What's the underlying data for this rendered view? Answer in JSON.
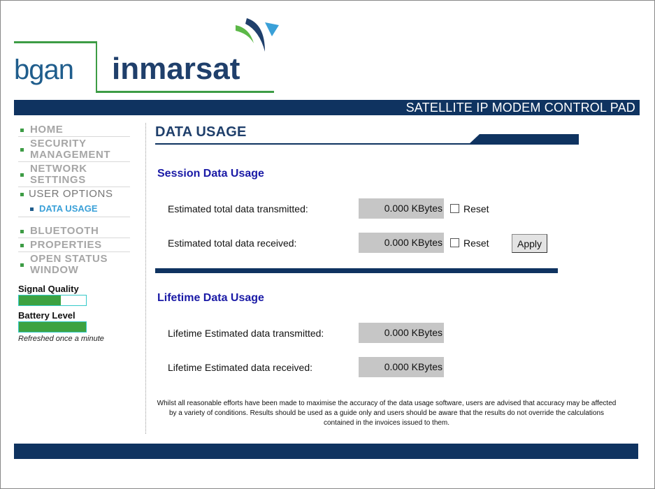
{
  "header": {
    "logo_left": "bgan",
    "logo_right": "inmarsat",
    "banner": "SATELLITE IP MODEM CONTROL PAD"
  },
  "sidebar": {
    "items": [
      {
        "label_1": "HOME",
        "label_2": ""
      },
      {
        "label_1": "SECURITY",
        "label_2": "MANAGEMENT"
      },
      {
        "label_1": "NETWORK",
        "label_2": "SETTINGS"
      },
      {
        "label_1": "USER OPTIONS",
        "label_2": ""
      },
      {
        "label_1": "BLUETOOTH",
        "label_2": ""
      },
      {
        "label_1": "PROPERTIES",
        "label_2": ""
      },
      {
        "label_1": "OPEN STATUS",
        "label_2": "WINDOW"
      }
    ],
    "sub_item": "DATA USAGE",
    "signal_title": "Signal Quality",
    "signal_level": 0.63,
    "battery_title": "Battery Level",
    "battery_level": 1.0,
    "refresh_note": "Refreshed once a minute"
  },
  "main": {
    "title": "DATA USAGE",
    "session": {
      "heading": "Session Data Usage",
      "rows": [
        {
          "label": "Estimated total data transmitted:",
          "value": "0.000 KBytes",
          "reset": "Reset"
        },
        {
          "label": "Estimated total data received:",
          "value": "0.000 KBytes",
          "reset": "Reset"
        }
      ],
      "apply_label": "Apply"
    },
    "lifetime": {
      "heading": "Lifetime Data Usage",
      "rows": [
        {
          "label": "Lifetime Estimated data transmitted:",
          "value": "0.000 KBytes"
        },
        {
          "label": "Lifetime Estimated data received:",
          "value": "0.000 KBytes"
        }
      ]
    },
    "disclaimer": "Whilst all reasonable efforts have been made to maximise the accuracy of the data usage software, users are advised that accuracy may be affected by a variety of conditions. Results should be used as a guide only and users should be aware that the results do not override the calculations contained in the invoices issued to them."
  },
  "colors": {
    "navy": "#0f3360",
    "green": "#3d9c45",
    "link_blue": "#3aa0d8",
    "heading_blue": "#1a1aa6"
  }
}
